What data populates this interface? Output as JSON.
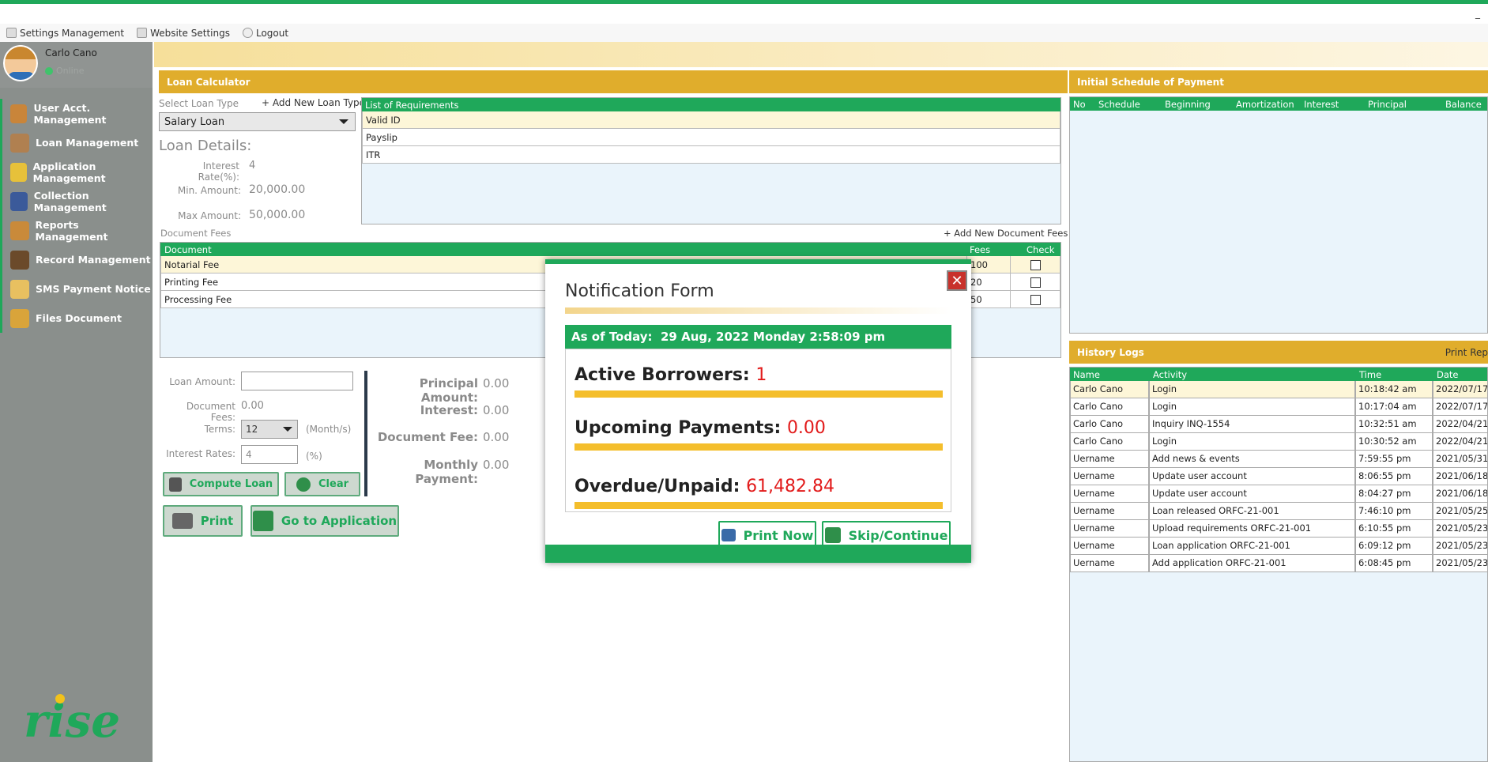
{
  "menubar": {
    "items": [
      "Settings Management",
      "Website Settings",
      "Logout"
    ],
    "minimize": "_"
  },
  "user": {
    "name": "Carlo Cano",
    "status": "Online"
  },
  "sidebar": {
    "items": [
      {
        "label": "User Acct. Management",
        "icon": "user-icon",
        "color": "#c9853a"
      },
      {
        "label": "Loan Management",
        "icon": "box-icon",
        "color": "#b08050"
      },
      {
        "label": "Application Management",
        "icon": "folder-add-icon",
        "color": "#e7c13a"
      },
      {
        "label": "Collection Management",
        "icon": "book-icon",
        "color": "#3b5a9a"
      },
      {
        "label": "Reports Management",
        "icon": "magnifier-icon",
        "color": "#c98a3a"
      },
      {
        "label": "Record Management",
        "icon": "person-icon",
        "color": "#6b4a2a"
      },
      {
        "label": "SMS Payment Notice",
        "icon": "envelope-icon",
        "color": "#e8c060"
      },
      {
        "label": "Files Document",
        "icon": "folder-icon",
        "color": "#d9a43a"
      }
    ]
  },
  "logo": {
    "text": "rise"
  },
  "loan_calc": {
    "title": "Loan Calculator",
    "select_label": "Select Loan Type",
    "add_type": "+ Add New Loan Type",
    "selected_type": "Salary Loan",
    "details_title": "Loan Details:",
    "interest_label": "Interest Rate(%):",
    "interest_value": "4",
    "min_label": "Min. Amount:",
    "min_value": "20,000.00",
    "max_label": "Max Amount:",
    "max_value": "50,000.00",
    "req_header": "List of Requirements",
    "requirements": [
      "Valid ID",
      "Payslip",
      "ITR"
    ],
    "doc_fees_label": "Document Fees",
    "add_doc_fees": "+ Add New Document Fees",
    "doc_headers": [
      "Document",
      "Fees",
      "Check"
    ],
    "documents": [
      {
        "name": "Notarial Fee",
        "fee": "100"
      },
      {
        "name": "Printing Fee",
        "fee": "20"
      },
      {
        "name": "Processing Fee",
        "fee": "50"
      }
    ],
    "loan_amount_label": "Loan Amount:",
    "doc_fees_total_label": "Document Fees:",
    "doc_fees_total": "0.00",
    "terms_label": "Terms:",
    "terms_value": "12",
    "terms_unit": "(Month/s)",
    "rates_label": "Interest Rates:",
    "rates_value": "4",
    "rates_unit": "(%)",
    "compute_btn": "Compute Loan",
    "clear_btn": "Clear",
    "print_btn": "Print",
    "goto_btn": "Go to Application",
    "summary": [
      {
        "label": "Principal Amount:",
        "value": "0.00"
      },
      {
        "label": "Interest:",
        "value": "0.00"
      },
      {
        "label": "Document Fee:",
        "value": "0.00"
      },
      {
        "label": "Monthly Payment:",
        "value": "0.00"
      }
    ]
  },
  "schedule": {
    "title": "Initial Schedule of Payment",
    "headers": [
      "No",
      "Schedule",
      "Beginning",
      "Amortization",
      "Interest",
      "Principal",
      "Balance"
    ]
  },
  "history": {
    "title": "History Logs",
    "print": "Print Rep",
    "headers": [
      "Name",
      "Activity",
      "Time",
      "Date"
    ],
    "rows": [
      [
        "Carlo Cano",
        "Login",
        "10:18:42 am",
        "2022/07/17"
      ],
      [
        "Carlo Cano",
        "Login",
        "10:17:04 am",
        "2022/07/17"
      ],
      [
        "Carlo Cano",
        "Inquiry INQ-1554",
        "10:32:51 am",
        "2022/04/21"
      ],
      [
        "Carlo Cano",
        "Login",
        "10:30:52 am",
        "2022/04/21"
      ],
      [
        "Uername",
        "Add news & events",
        "7:59:55 pm",
        "2021/05/31"
      ],
      [
        "Uername",
        "Update user account",
        "8:06:55 pm",
        "2021/06/18"
      ],
      [
        "Uername",
        "Update user account",
        "8:04:27 pm",
        "2021/06/18"
      ],
      [
        "Uername",
        "Loan released ORFC-21-001",
        "7:46:10 pm",
        "2021/05/25"
      ],
      [
        "Uername",
        "Upload requirements ORFC-21-001",
        "6:10:55 pm",
        "2021/05/23"
      ],
      [
        "Uername",
        "Loan application ORFC-21-001",
        "6:09:12 pm",
        "2021/05/23"
      ],
      [
        "Uername",
        "Add application ORFC-21-001",
        "6:08:45 pm",
        "2021/05/23"
      ]
    ]
  },
  "modal": {
    "title": "Notification Form",
    "close": "✕",
    "today_label": "As of Today:",
    "today_value": "29 Aug, 2022 Monday 2:58:09 pm",
    "active_label": "Active Borrowers:",
    "active_value": "1",
    "upcoming_label": "Upcoming Payments:",
    "upcoming_value": "0.00",
    "overdue_label": "Overdue/Unpaid:",
    "overdue_value": "61,482.84",
    "print_btn": "Print Now",
    "skip_btn": "Skip/Continue"
  }
}
